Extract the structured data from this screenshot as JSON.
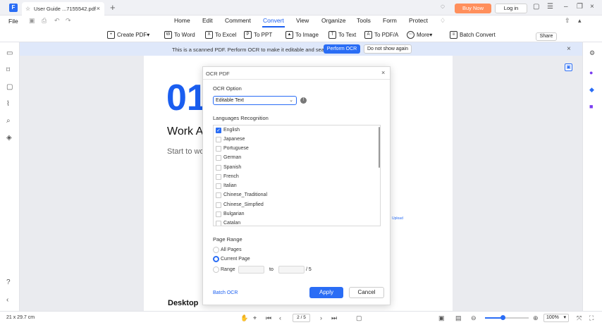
{
  "titlebar": {
    "tab_label": "User Guide ...7155542.pdf",
    "buy_now": "Buy Now",
    "login": "Log in"
  },
  "menubar": {
    "file": "File",
    "items": [
      "Home",
      "Edit",
      "Comment",
      "Convert",
      "View",
      "Organize",
      "Tools",
      "Form",
      "Protect"
    ],
    "active": "Convert",
    "share": "Share"
  },
  "toolbar": {
    "create_pdf": "Create PDF",
    "tools": [
      "To Word",
      "To Excel",
      "To PPT",
      "To Image",
      "To Text",
      "To PDF/A",
      "More"
    ],
    "batch_convert": "Batch Convert"
  },
  "banner": {
    "text": "This is a scanned PDF. Perform OCR to make it editable and searchable.",
    "perform_ocr": "Perform OCR",
    "dont_show": "Do not show again"
  },
  "page": {
    "number": "01",
    "title": "Work A",
    "subtitle": "Start to wo",
    "bottom_heading": "Desktop",
    "side_link": "Upload"
  },
  "dialog": {
    "title": "OCR PDF",
    "ocr_option_label": "OCR Option",
    "ocr_option_value": "Editable Text",
    "languages_label": "Languages Recognition",
    "languages": [
      {
        "name": "English",
        "checked": true
      },
      {
        "name": "Japanese",
        "checked": false
      },
      {
        "name": "Portuguese",
        "checked": false
      },
      {
        "name": "German",
        "checked": false
      },
      {
        "name": "Spanish",
        "checked": false
      },
      {
        "name": "French",
        "checked": false
      },
      {
        "name": "Italian",
        "checked": false
      },
      {
        "name": "Chinese_Traditional",
        "checked": false
      },
      {
        "name": "Chinese_Simpfied",
        "checked": false
      },
      {
        "name": "Bulgarian",
        "checked": false
      },
      {
        "name": "Catalan",
        "checked": false
      }
    ],
    "page_range_label": "Page Range",
    "all_pages": "All Pages",
    "current_page": "Current Page",
    "range": "Range",
    "range_to": "to",
    "range_total": "/ 5",
    "batch_ocr": "Batch OCR",
    "apply": "Apply",
    "cancel": "Cancel"
  },
  "statusbar": {
    "page_size": "21 x 29.7 cm",
    "page_indicator": "2 / 5",
    "zoom": "100%",
    "zoom_fraction": 0.4
  },
  "colors": {
    "accent": "#2a6df5",
    "buy_now": "#ff8f5c",
    "banner": "#dfe8fa"
  }
}
